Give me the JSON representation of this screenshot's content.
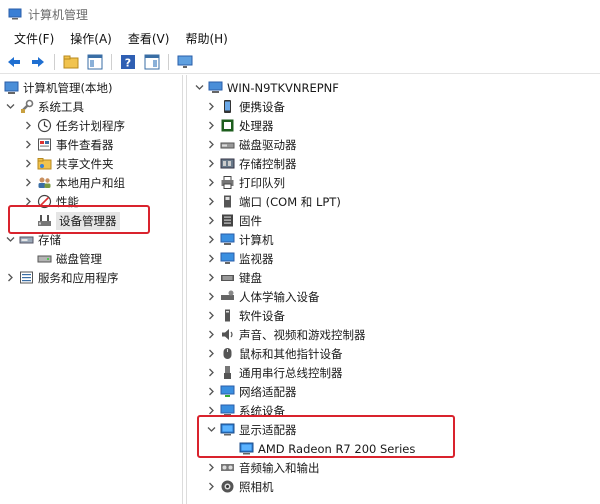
{
  "window": {
    "title": "计算机管理"
  },
  "menu": [
    "文件(F)",
    "操作(A)",
    "查看(V)",
    "帮助(H)"
  ],
  "toolbar": {
    "icons": [
      "back-arrow-icon",
      "forward-arrow-icon",
      "folder-up-icon",
      "console-tree-icon",
      "help-icon",
      "show-hide-icon",
      "monitor-icon"
    ]
  },
  "left_tree": {
    "root": "计算机管理(本地)",
    "system_tools": "系统工具",
    "task_scheduler": "任务计划程序",
    "event_viewer": "事件查看器",
    "shared_folders": "共享文件夹",
    "local_users": "本地用户和组",
    "performance": "性能",
    "device_manager": "设备管理器",
    "storage": "存储",
    "disk_management": "磁盘管理",
    "services_apps": "服务和应用程序"
  },
  "right_tree": {
    "computer_name": "WIN-N9TKVNREPNF",
    "categories": [
      "便携设备",
      "处理器",
      "磁盘驱动器",
      "存储控制器",
      "打印队列",
      "端口 (COM 和 LPT)",
      "固件",
      "计算机",
      "监视器",
      "键盘",
      "人体学输入设备",
      "软件设备",
      "声音、视频和游戏控制器",
      "鼠标和其他指针设备",
      "通用串行总线控制器",
      "网络适配器",
      "系统设备",
      "显示适配器",
      "音频输入和输出",
      "照相机"
    ],
    "display_adapter_child": "AMD Radeon R7 200 Series"
  }
}
